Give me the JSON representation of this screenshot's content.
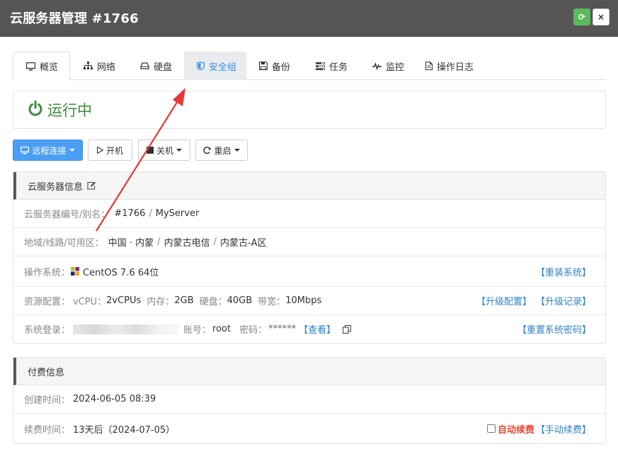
{
  "window": {
    "title": "云服务器管理 #1766",
    "refresh_glyph": "⟳",
    "close_glyph": "×"
  },
  "tabs": [
    {
      "label": "概览",
      "icon": "monitor-icon"
    },
    {
      "label": "网络",
      "icon": "sitemap-icon"
    },
    {
      "label": "硬盘",
      "icon": "hdd-icon"
    },
    {
      "label": "安全组",
      "icon": "shield-icon"
    },
    {
      "label": "备份",
      "icon": "save-icon"
    },
    {
      "label": "任务",
      "icon": "tasks-icon"
    },
    {
      "label": "监控",
      "icon": "pulse-icon"
    },
    {
      "label": "操作日志",
      "icon": "file-icon"
    }
  ],
  "status": {
    "text": "运行中",
    "color": "#3c8b3c"
  },
  "actions": {
    "remote": "远程连接",
    "start": "开机",
    "shutdown": "关机",
    "restart": "重启"
  },
  "server_info": {
    "heading": "云服务器信息",
    "id_label": "云服务器编号/别名：",
    "id": "#1766",
    "slash": "/",
    "alias": "MyServer",
    "region_label": "地域/线路/可用区：",
    "region": "中国 · 内蒙",
    "line": "内蒙古电信",
    "zone": "内蒙古-A区",
    "os_label": "操作系统：",
    "os": "CentOS 7.6 64位",
    "reinstall": "【重装系统】",
    "res_label": "资源配置：",
    "vcpu_label": "vCPU：",
    "vcpu": "2vCPUs",
    "mem_label": "内存：",
    "mem": "2GB",
    "disk_label": "硬盘：",
    "disk": "40GB",
    "bw_label": "带宽：",
    "bw": "10Mbps",
    "upgrade": "【升级配置】",
    "upgrade_log": "【升级记录】",
    "login_label": "系统登录：",
    "account_label": "账号：",
    "account": "root",
    "pwd_label": "密码：",
    "pwd": "******",
    "view": "【查看】",
    "reset_pwd": "【重置系统密码】"
  },
  "billing": {
    "heading": "付费信息",
    "created_label": "创建时间：",
    "created": "2024-06-05 08:39",
    "renew_label": "续费时间：",
    "renew": "13天后（2024-07-05）",
    "auto_renew": "自动续费",
    "manual_renew": "【手动续费】"
  },
  "colors": {
    "primary": "#4a9ff5",
    "link": "#2f83c9",
    "success": "#5cb85c",
    "danger": "#e74c3c",
    "annotation": "#e53935"
  }
}
